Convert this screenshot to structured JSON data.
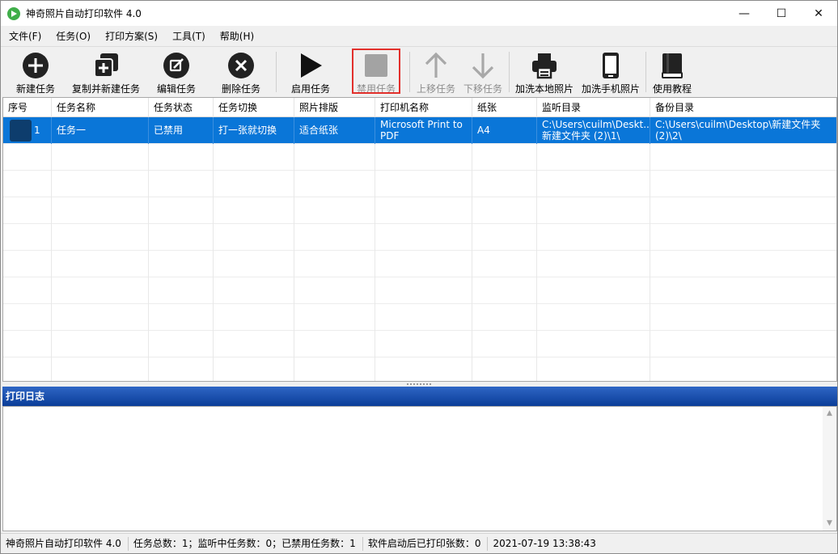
{
  "window": {
    "title": "神奇照片自动打印软件 4.0"
  },
  "window_controls": {
    "minimize": "—",
    "maximize": "☐",
    "close": "✕"
  },
  "menu": [
    "文件(F)",
    "任务(O)",
    "打印方案(S)",
    "工具(T)",
    "帮助(H)"
  ],
  "toolbar": {
    "new_task": "新建任务",
    "copy_new_task": "复制并新建任务",
    "edit_task": "编辑任务",
    "delete_task": "删除任务",
    "enable_task": "启用任务",
    "disable_task": "禁用任务",
    "move_up": "上移任务",
    "move_down": "下移任务",
    "add_local_photos": "加洗本地照片",
    "add_phone_photos": "加洗手机照片",
    "tutorial": "使用教程"
  },
  "table": {
    "columns": [
      "序号",
      "任务名称",
      "任务状态",
      "任务切换",
      "照片排版",
      "打印机名称",
      "纸张",
      "监听目录",
      "备份目录"
    ],
    "rows": [
      {
        "index": "1",
        "name": "任务一",
        "status": "已禁用",
        "switch": "打一张就切换",
        "layout": "适合纸张",
        "printer_line1": "Microsoft Print to",
        "printer_line2": "PDF",
        "paper": "A4",
        "watch_line1": "C:\\Users\\cuilm\\Deskt...",
        "watch_line2": "新建文件夹 (2)\\1\\",
        "backup_line1": "C:\\Users\\cuilm\\Desktop\\新建文件夹",
        "backup_line2": "(2)\\2\\"
      }
    ]
  },
  "log": {
    "title": "打印日志"
  },
  "status": {
    "app": "神奇照片自动打印软件 4.0",
    "counts": "任务总数：1；监听中任务数：0；已禁用任务数：1",
    "printed": "软件启动后已打印张数：0",
    "datetime": "2021-07-19 13:38:43"
  },
  "colors": {
    "selection": "#0a76d8",
    "log_header": "#0a3d98",
    "highlight_border": "#e2302c"
  }
}
